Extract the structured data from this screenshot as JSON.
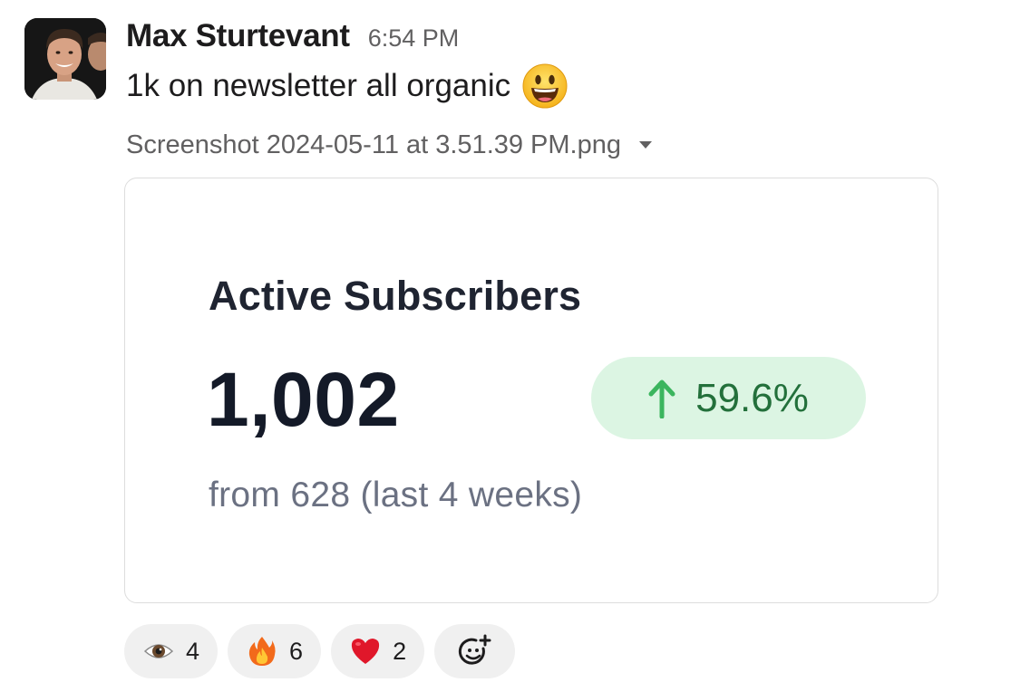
{
  "message": {
    "sender": "Max Sturtevant",
    "time": "6:54 PM",
    "text": "1k on newsletter all organic",
    "text_emoji": "smiley-icon"
  },
  "attachment": {
    "filename": "Screenshot 2024-05-11 at 3.51.39 PM.png",
    "card": {
      "title": "Active Subscribers",
      "value": "1,002",
      "change": "59.6%",
      "change_direction": "up",
      "subtitle": "from 628 (last 4 weeks)"
    }
  },
  "reactions": [
    {
      "emoji": "eyes-icon",
      "count": "4"
    },
    {
      "emoji": "fire-icon",
      "count": "6"
    },
    {
      "emoji": "heart-icon",
      "count": "2"
    }
  ],
  "colors": {
    "change_pill_bg": "#dcf5e3",
    "change_text": "#23703b",
    "change_arrow": "#3bb55e",
    "reaction_bg": "#f0f0f0"
  }
}
